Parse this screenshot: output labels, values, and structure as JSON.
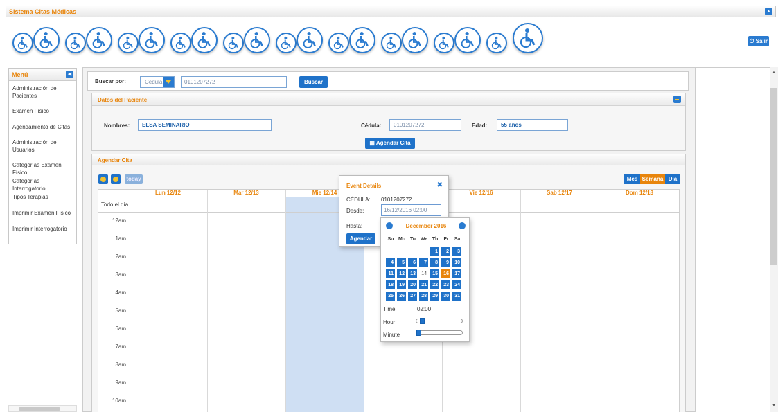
{
  "app": {
    "title": "Sistema Citas Médicas"
  },
  "header": {
    "icons": [
      "wheelchair-icon",
      "wheelchair-icon",
      "wheelchair-icon",
      "wheelchair-icon",
      "wheelchair-icon",
      "wheelchair-icon",
      "wheelchair-icon",
      "wheelchair-icon",
      "wheelchair-icon",
      "wheelchair-icon",
      "wheelchair-icon",
      "wheelchair-icon",
      "wheelchair-icon",
      "wheelchair-icon",
      "wheelchair-icon",
      "wheelchair-icon",
      "wheelchair-icon",
      "wheelchair-icon",
      "wheelchair-icon",
      "wheelchair-icon"
    ],
    "logout_label": "Salir",
    "logout_icon": "power-icon"
  },
  "sidebar": {
    "title": "Menú",
    "items": [
      {
        "label": "Administración de Pacientes"
      },
      {
        "label": "Examen Físico"
      },
      {
        "label": "Agendamiento de Citas"
      },
      {
        "label": "Administración de Usuarios"
      },
      {
        "label": "Categorías Examen Físico"
      },
      {
        "label": "Categorías Interrogatorio"
      },
      {
        "label": "Tipos Terapias"
      },
      {
        "label": "Imprimir Examen Físico"
      },
      {
        "label": "Imprimir Interrogatorio"
      }
    ]
  },
  "search": {
    "label": "Buscar por:",
    "selected": "Cédula",
    "value": "0101207272",
    "button": "Buscar"
  },
  "patient": {
    "title": "Datos del Paciente",
    "nombres_label": "Nombres:",
    "nombres": "ELSA SEMINARIO",
    "cedula_label": "Cédula:",
    "cedula": "0101207272",
    "edad_label": "Edad:",
    "edad": "55 años",
    "agendar_button": "Agendar Cita"
  },
  "calendar": {
    "title": "Agendar Cita",
    "today_label": "today",
    "views": [
      "Mes",
      "Semana",
      "Día"
    ],
    "active_view": "Semana",
    "columns": [
      "Lun 12/12",
      "Mar 12/13",
      "Mie 12/14",
      "Jue 12/15",
      "Vie 12/16",
      "Sab 12/17",
      "Dom 12/18"
    ],
    "allday_label": "Todo el día",
    "hours": [
      "12am",
      "1am",
      "2am",
      "3am",
      "4am",
      "5am",
      "6am",
      "7am",
      "8am",
      "9am",
      "10am"
    ]
  },
  "event_popup": {
    "title": "Event Details",
    "cedula_label": "CÉDULA:",
    "cedula": "0101207272",
    "desde_label": "Desde:",
    "desde": "16/12/2016 02:00",
    "hasta_label": "Hasta:",
    "agendar_button": "Agendar"
  },
  "datepicker": {
    "month": "December 2016",
    "weekdays": [
      "Su",
      "Mo",
      "Tu",
      "We",
      "Th",
      "Fr",
      "Sa"
    ],
    "weeks": [
      [
        "",
        "",
        "",
        "",
        "1",
        "2",
        "3"
      ],
      [
        "4",
        "5",
        "6",
        "7",
        "8",
        "9",
        "10"
      ],
      [
        "11",
        "12",
        "13",
        "14",
        "15",
        "16",
        "17"
      ],
      [
        "18",
        "19",
        "20",
        "21",
        "22",
        "23",
        "24"
      ],
      [
        "25",
        "26",
        "27",
        "28",
        "29",
        "30",
        "31"
      ]
    ],
    "selected_day": "16",
    "today_day": "14",
    "time_label": "Time",
    "time_value": "02:00",
    "hour_label": "Hour",
    "minute_label": "Minute",
    "hour_fraction": 0.08,
    "minute_fraction": 0.0
  },
  "colors": {
    "accent": "#e8850c",
    "primary": "#1f72c9",
    "highlight_col": "#cfdff3"
  }
}
